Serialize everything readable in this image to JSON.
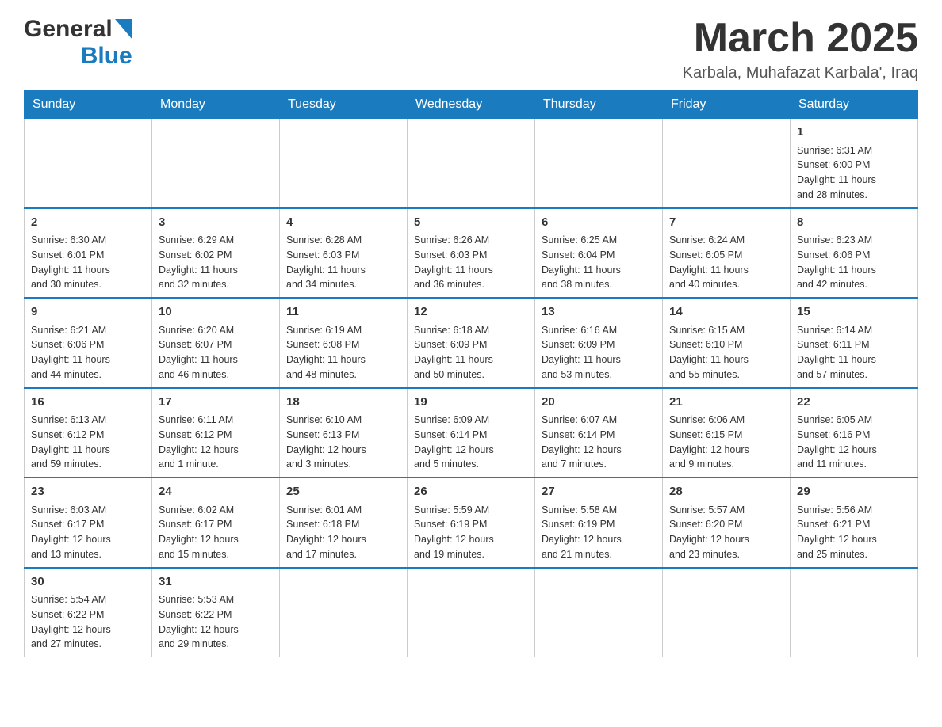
{
  "header": {
    "month_title": "March 2025",
    "location": "Karbala, Muhafazat Karbala', Iraq",
    "logo_general": "General",
    "logo_blue": "Blue"
  },
  "days_of_week": [
    "Sunday",
    "Monday",
    "Tuesday",
    "Wednesday",
    "Thursday",
    "Friday",
    "Saturday"
  ],
  "weeks": [
    [
      {
        "day": "",
        "info": ""
      },
      {
        "day": "",
        "info": ""
      },
      {
        "day": "",
        "info": ""
      },
      {
        "day": "",
        "info": ""
      },
      {
        "day": "",
        "info": ""
      },
      {
        "day": "",
        "info": ""
      },
      {
        "day": "1",
        "info": "Sunrise: 6:31 AM\nSunset: 6:00 PM\nDaylight: 11 hours\nand 28 minutes."
      }
    ],
    [
      {
        "day": "2",
        "info": "Sunrise: 6:30 AM\nSunset: 6:01 PM\nDaylight: 11 hours\nand 30 minutes."
      },
      {
        "day": "3",
        "info": "Sunrise: 6:29 AM\nSunset: 6:02 PM\nDaylight: 11 hours\nand 32 minutes."
      },
      {
        "day": "4",
        "info": "Sunrise: 6:28 AM\nSunset: 6:03 PM\nDaylight: 11 hours\nand 34 minutes."
      },
      {
        "day": "5",
        "info": "Sunrise: 6:26 AM\nSunset: 6:03 PM\nDaylight: 11 hours\nand 36 minutes."
      },
      {
        "day": "6",
        "info": "Sunrise: 6:25 AM\nSunset: 6:04 PM\nDaylight: 11 hours\nand 38 minutes."
      },
      {
        "day": "7",
        "info": "Sunrise: 6:24 AM\nSunset: 6:05 PM\nDaylight: 11 hours\nand 40 minutes."
      },
      {
        "day": "8",
        "info": "Sunrise: 6:23 AM\nSunset: 6:06 PM\nDaylight: 11 hours\nand 42 minutes."
      }
    ],
    [
      {
        "day": "9",
        "info": "Sunrise: 6:21 AM\nSunset: 6:06 PM\nDaylight: 11 hours\nand 44 minutes."
      },
      {
        "day": "10",
        "info": "Sunrise: 6:20 AM\nSunset: 6:07 PM\nDaylight: 11 hours\nand 46 minutes."
      },
      {
        "day": "11",
        "info": "Sunrise: 6:19 AM\nSunset: 6:08 PM\nDaylight: 11 hours\nand 48 minutes."
      },
      {
        "day": "12",
        "info": "Sunrise: 6:18 AM\nSunset: 6:09 PM\nDaylight: 11 hours\nand 50 minutes."
      },
      {
        "day": "13",
        "info": "Sunrise: 6:16 AM\nSunset: 6:09 PM\nDaylight: 11 hours\nand 53 minutes."
      },
      {
        "day": "14",
        "info": "Sunrise: 6:15 AM\nSunset: 6:10 PM\nDaylight: 11 hours\nand 55 minutes."
      },
      {
        "day": "15",
        "info": "Sunrise: 6:14 AM\nSunset: 6:11 PM\nDaylight: 11 hours\nand 57 minutes."
      }
    ],
    [
      {
        "day": "16",
        "info": "Sunrise: 6:13 AM\nSunset: 6:12 PM\nDaylight: 11 hours\nand 59 minutes."
      },
      {
        "day": "17",
        "info": "Sunrise: 6:11 AM\nSunset: 6:12 PM\nDaylight: 12 hours\nand 1 minute."
      },
      {
        "day": "18",
        "info": "Sunrise: 6:10 AM\nSunset: 6:13 PM\nDaylight: 12 hours\nand 3 minutes."
      },
      {
        "day": "19",
        "info": "Sunrise: 6:09 AM\nSunset: 6:14 PM\nDaylight: 12 hours\nand 5 minutes."
      },
      {
        "day": "20",
        "info": "Sunrise: 6:07 AM\nSunset: 6:14 PM\nDaylight: 12 hours\nand 7 minutes."
      },
      {
        "day": "21",
        "info": "Sunrise: 6:06 AM\nSunset: 6:15 PM\nDaylight: 12 hours\nand 9 minutes."
      },
      {
        "day": "22",
        "info": "Sunrise: 6:05 AM\nSunset: 6:16 PM\nDaylight: 12 hours\nand 11 minutes."
      }
    ],
    [
      {
        "day": "23",
        "info": "Sunrise: 6:03 AM\nSunset: 6:17 PM\nDaylight: 12 hours\nand 13 minutes."
      },
      {
        "day": "24",
        "info": "Sunrise: 6:02 AM\nSunset: 6:17 PM\nDaylight: 12 hours\nand 15 minutes."
      },
      {
        "day": "25",
        "info": "Sunrise: 6:01 AM\nSunset: 6:18 PM\nDaylight: 12 hours\nand 17 minutes."
      },
      {
        "day": "26",
        "info": "Sunrise: 5:59 AM\nSunset: 6:19 PM\nDaylight: 12 hours\nand 19 minutes."
      },
      {
        "day": "27",
        "info": "Sunrise: 5:58 AM\nSunset: 6:19 PM\nDaylight: 12 hours\nand 21 minutes."
      },
      {
        "day": "28",
        "info": "Sunrise: 5:57 AM\nSunset: 6:20 PM\nDaylight: 12 hours\nand 23 minutes."
      },
      {
        "day": "29",
        "info": "Sunrise: 5:56 AM\nSunset: 6:21 PM\nDaylight: 12 hours\nand 25 minutes."
      }
    ],
    [
      {
        "day": "30",
        "info": "Sunrise: 5:54 AM\nSunset: 6:22 PM\nDaylight: 12 hours\nand 27 minutes."
      },
      {
        "day": "31",
        "info": "Sunrise: 5:53 AM\nSunset: 6:22 PM\nDaylight: 12 hours\nand 29 minutes."
      },
      {
        "day": "",
        "info": ""
      },
      {
        "day": "",
        "info": ""
      },
      {
        "day": "",
        "info": ""
      },
      {
        "day": "",
        "info": ""
      },
      {
        "day": "",
        "info": ""
      }
    ]
  ]
}
